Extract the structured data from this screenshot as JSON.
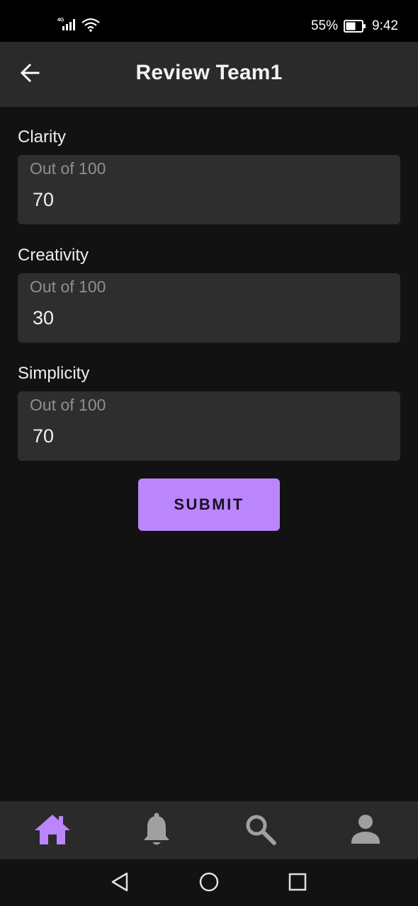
{
  "status_bar": {
    "network": "4G",
    "battery_percent": "55%",
    "time": "9:42"
  },
  "app_bar": {
    "title": "Review Team1",
    "back_icon": "arrow-back-icon"
  },
  "form": {
    "fields": [
      {
        "label": "Clarity",
        "placeholder": "Out of 100",
        "value": "70"
      },
      {
        "label": "Creativity",
        "placeholder": "Out of 100",
        "value": "30"
      },
      {
        "label": "Simplicity",
        "placeholder": "Out of 100",
        "value": "70"
      }
    ],
    "submit_label": "SUBMIT"
  },
  "bottom_nav": {
    "items": [
      {
        "icon": "home-icon",
        "active": true
      },
      {
        "icon": "bell-icon",
        "active": false
      },
      {
        "icon": "search-icon",
        "active": false
      },
      {
        "icon": "person-icon",
        "active": false
      }
    ]
  },
  "system_nav": {
    "items": [
      "back-triangle-icon",
      "home-circle-icon",
      "recents-square-icon"
    ]
  },
  "colors": {
    "accent": "#bb86fc",
    "background": "#121212",
    "surface": "#2a2a2a",
    "inactive_icon": "#a0a0a0"
  }
}
